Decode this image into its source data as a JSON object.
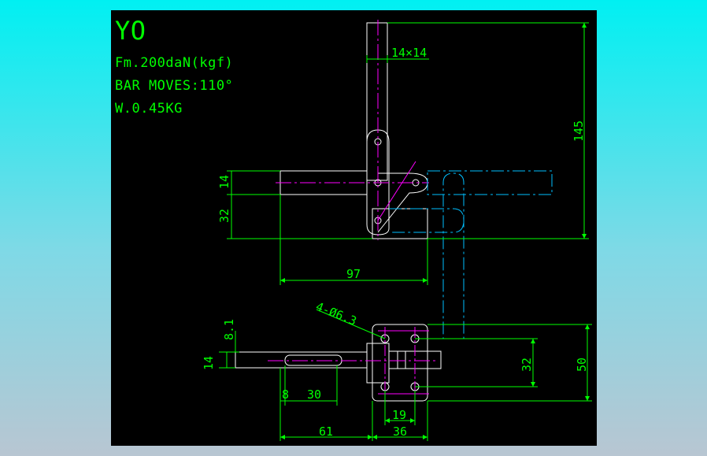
{
  "specs": {
    "model": "YO",
    "force": "Fm.200daN(kgf)",
    "bar_moves": "BAR MOVES:110°",
    "weight": "W.0.45KG"
  },
  "dimensions": {
    "d_14x14": "14×14",
    "d_145": "145",
    "d_14_top": "14",
    "d_32_top": "32",
    "d_97": "97",
    "d_holes": "4-Ø6.3",
    "d_8_1": "8.1",
    "d_14_bottom": "14",
    "d_32_right": "32",
    "d_50": "50",
    "d_8": "8",
    "d_30": "30",
    "d_19": "19",
    "d_61": "61",
    "d_36": "36"
  },
  "colors": {
    "background_canvas": "#000000",
    "outline": "#ffffff",
    "dimension": "#00ff00",
    "centerline": "#ff00ff",
    "phantom": "#00bfff",
    "text": "#00ff00"
  }
}
